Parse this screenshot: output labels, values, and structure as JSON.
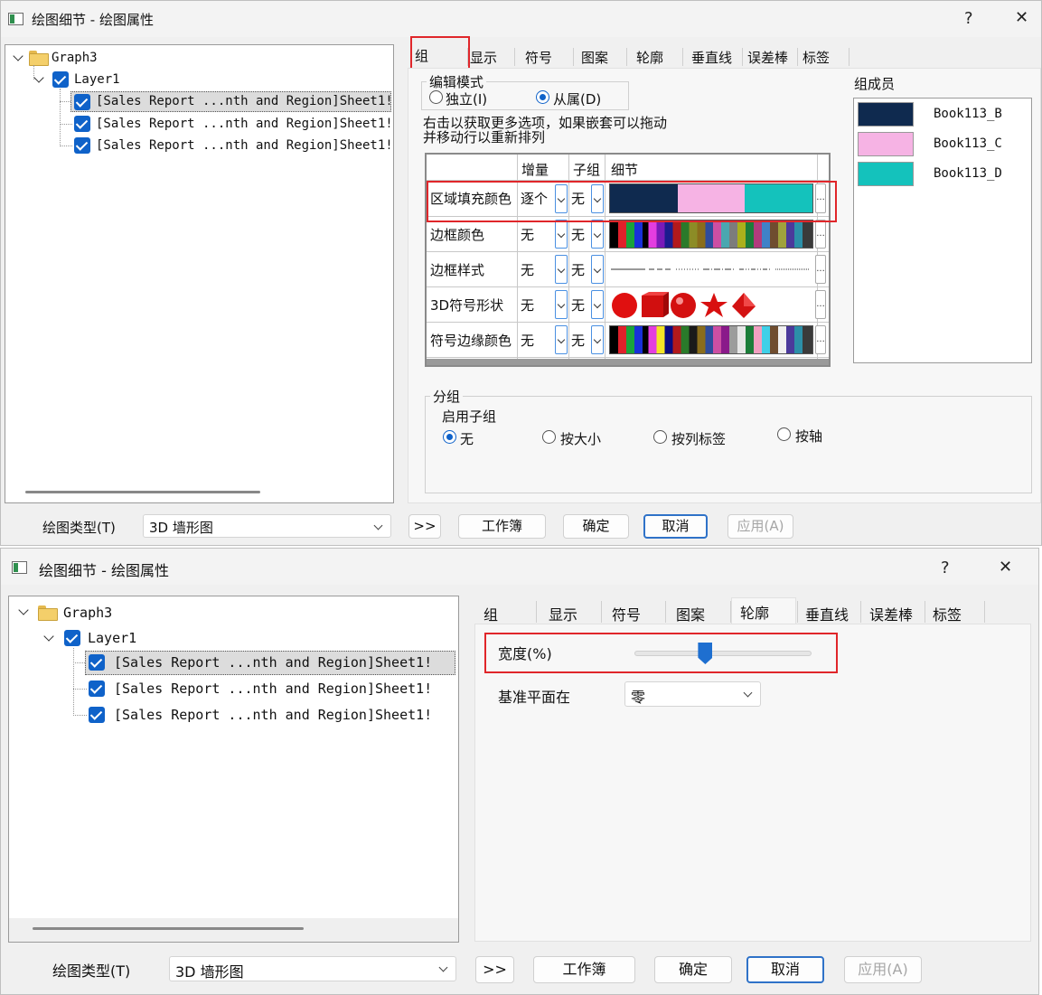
{
  "window": {
    "title": "绘图细节 - 绘图属性",
    "help_label": "?",
    "close_label": "✕"
  },
  "tree": {
    "root": "Graph3",
    "layer": "Layer1",
    "items": [
      "[Sales Report ...nth and Region]Sheet1!",
      "[Sales Report ...nth and Region]Sheet1!",
      "[Sales Report ...nth and Region]Sheet1!"
    ]
  },
  "tabs": [
    "组",
    "显示",
    "符号",
    "图案",
    "轮廓",
    "垂直线",
    "误差棒",
    "标签"
  ],
  "group_tab": {
    "edit_mode": {
      "label": "编辑模式",
      "options": [
        "独立(I)",
        "从属(D)"
      ],
      "selected": "从属(D)"
    },
    "hint_line1": "右击以获取更多选项，如果嵌套可以拖动",
    "hint_line2": "并移动行以重新排列",
    "grid_headers": {
      "increment": "增量",
      "subgroup": "子组",
      "detail": "细节"
    },
    "grid_rows": [
      {
        "name": "区域填充颜色",
        "increment": "逐个",
        "subgroup": "无",
        "detail": "fill-color-list"
      },
      {
        "name": "边框颜色",
        "increment": "无",
        "subgroup": "无",
        "detail": "border-color-list"
      },
      {
        "name": "边框样式",
        "increment": "无",
        "subgroup": "无",
        "detail": "border-style-list"
      },
      {
        "name": "3D符号形状",
        "increment": "无",
        "subgroup": "无",
        "detail": "3d-shape-list"
      },
      {
        "name": "符号边缘颜色",
        "increment": "无",
        "subgroup": "无",
        "detail": "edge-color-list"
      }
    ],
    "ellipsis": "...",
    "members": {
      "label": "组成员",
      "items": [
        {
          "name": "Book113_B",
          "color": "#0f2a4f"
        },
        {
          "name": "Book113_C",
          "color": "#f6b3e4"
        },
        {
          "name": "Book113_D",
          "color": "#14c2bc"
        }
      ]
    },
    "grouping": {
      "label": "分组",
      "sub_label": "启用子组",
      "options": [
        "无",
        "按大小",
        "按列标签",
        "按轴"
      ],
      "selected": "无"
    }
  },
  "outline_tab": {
    "width_label": "宽度(%)",
    "width_value_fraction": 0.4,
    "baseline_label": "基准平面在",
    "baseline_value": "零"
  },
  "bottom": {
    "plot_type_label": "绘图类型(T)",
    "plot_type_value": "3D 墙形图",
    "expand": ">>",
    "workbook": "工作簿",
    "ok": "确定",
    "cancel": "取消",
    "apply": "应用(A)"
  },
  "colors": {
    "accent": "#0f62c9",
    "highlight": "#e0262a"
  }
}
